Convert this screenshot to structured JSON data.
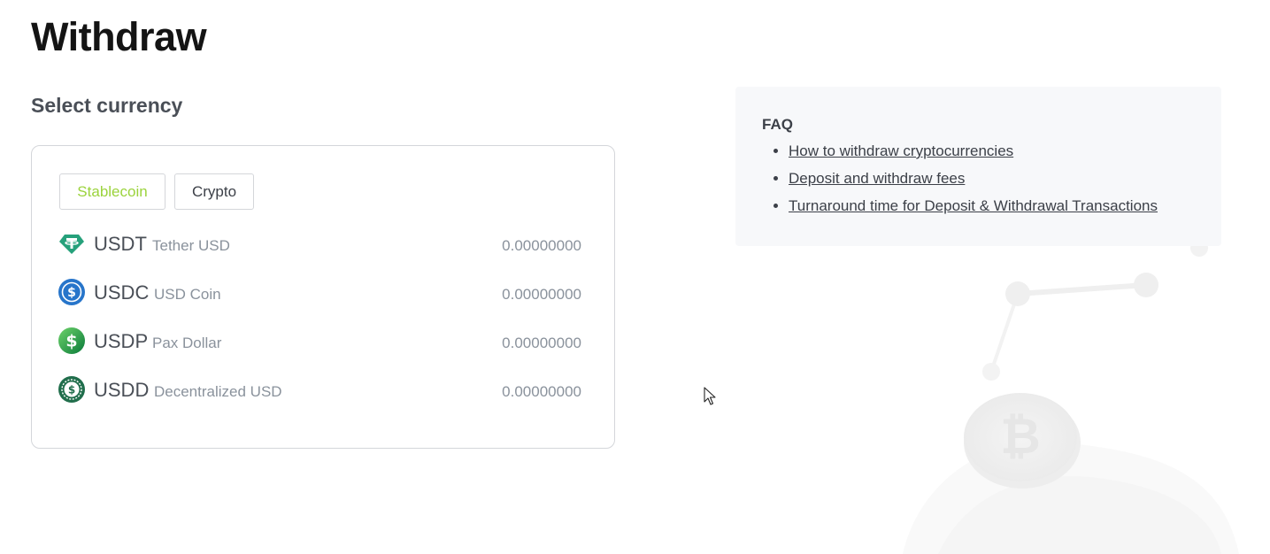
{
  "page": {
    "title": "Withdraw",
    "section_title": "Select currency"
  },
  "tabs": {
    "stablecoin_label": "Stablecoin",
    "crypto_label": "Crypto",
    "active": "Stablecoin"
  },
  "currencies": [
    {
      "symbol": "USDT",
      "name": "Tether USD",
      "balance": "0.00000000",
      "icon": "tether-icon"
    },
    {
      "symbol": "USDC",
      "name": "USD Coin",
      "balance": "0.00000000",
      "icon": "usd-coin-icon"
    },
    {
      "symbol": "USDP",
      "name": "Pax Dollar",
      "balance": "0.00000000",
      "icon": "pax-dollar-icon"
    },
    {
      "symbol": "USDD",
      "name": "Decentralized USD",
      "balance": "0.00000000",
      "icon": "decentralized-usd-icon"
    }
  ],
  "faq": {
    "title": "FAQ",
    "links": [
      "How to withdraw cryptocurrencies",
      "Deposit and withdraw fees",
      "Turnaround time for Deposit & Withdrawal Transactions"
    ]
  },
  "colors": {
    "accent_green": "#9bd33c",
    "text_dark": "#141414",
    "text_muted": "#8a929c",
    "faq_background": "#f7f8fa"
  }
}
